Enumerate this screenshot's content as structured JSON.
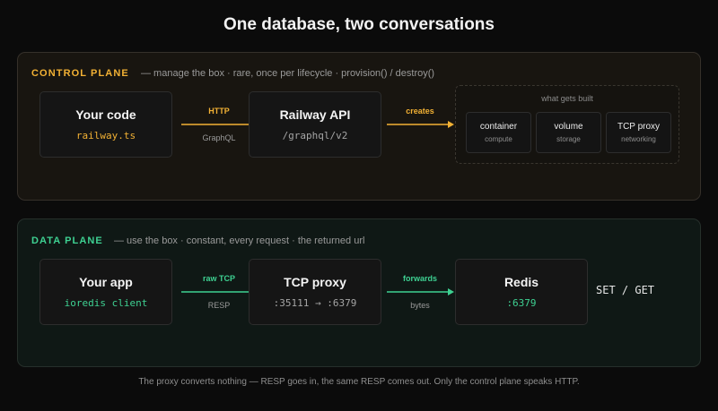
{
  "title": "One database, two conversations",
  "control_plane": {
    "label": "CONTROL PLANE",
    "description": "— manage the box · rare, once per lifecycle · provision() / destroy()",
    "accent": "#f2b134",
    "nodes": [
      {
        "name": "Your code",
        "sub": "railway.ts"
      },
      {
        "name": "Railway API",
        "sub": "/graphql/v2"
      }
    ],
    "arrows": [
      {
        "label": "HTTP",
        "sublabel": "GraphQL"
      },
      {
        "label": "creates",
        "sublabel": ""
      }
    ],
    "built": {
      "heading": "what gets built",
      "items": [
        {
          "name": "container",
          "sub": "compute"
        },
        {
          "name": "volume",
          "sub": "storage"
        },
        {
          "name": "TCP proxy",
          "sub": "networking"
        }
      ]
    }
  },
  "data_plane": {
    "label": "DATA PLANE",
    "description": "— use the box · constant, every request · the returned url",
    "accent": "#3ed192",
    "nodes": [
      {
        "name": "Your app",
        "sub": "ioredis client"
      },
      {
        "name": "TCP proxy",
        "sub": ":35111 → :6379"
      },
      {
        "name": "Redis",
        "sub": ":6379"
      }
    ],
    "arrows": [
      {
        "label": "raw TCP",
        "sublabel": "RESP"
      },
      {
        "label": "forwards",
        "sublabel": "bytes"
      }
    ],
    "commands": "SET / GET"
  },
  "footer": "The proxy converts nothing — RESP goes in, the same RESP comes out. Only the control plane speaks HTTP."
}
